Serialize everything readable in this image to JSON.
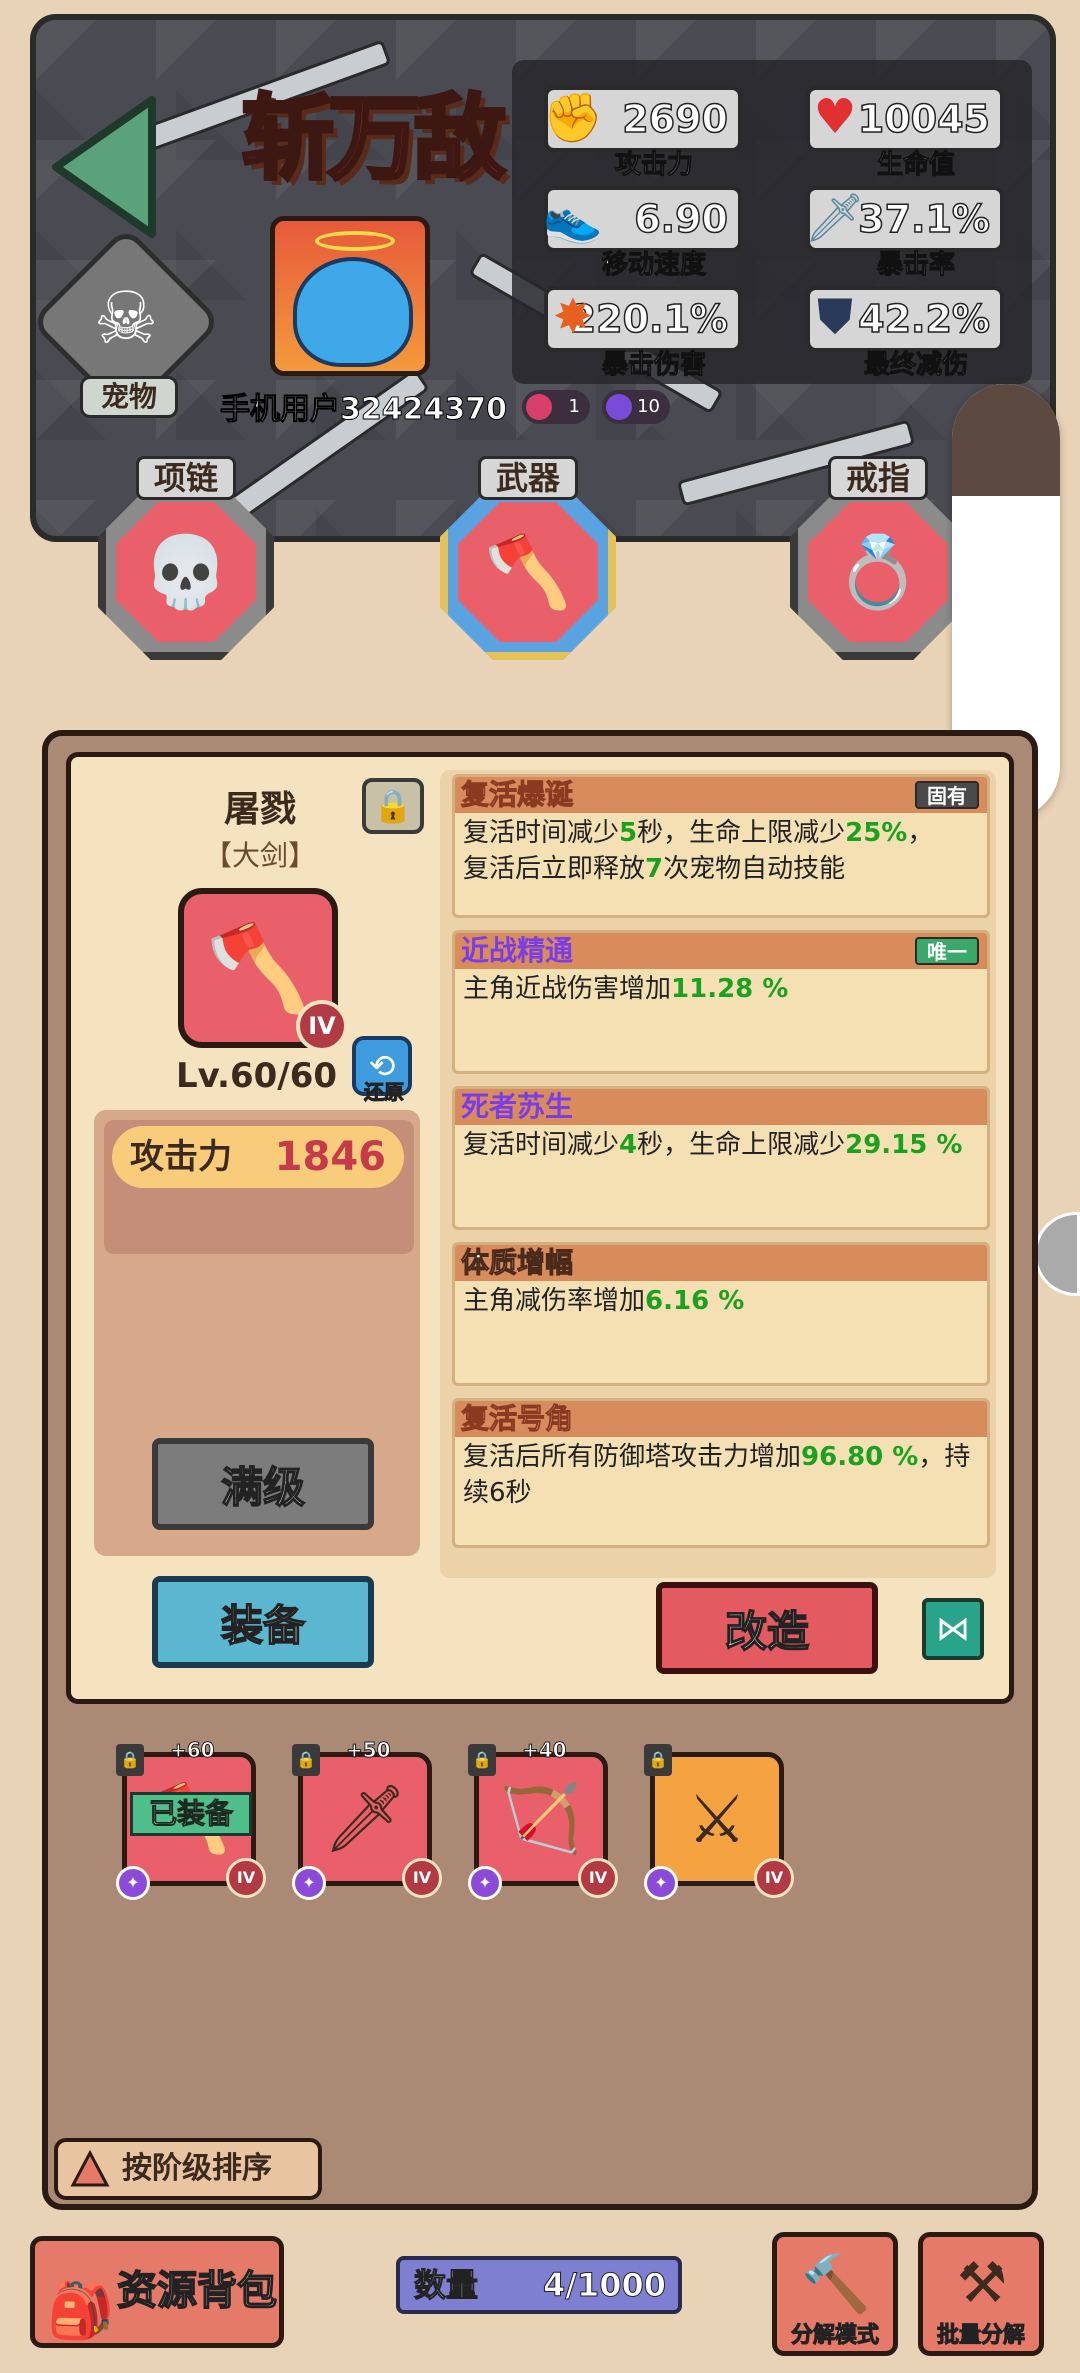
{
  "header": {
    "logo_text": "斩万敌",
    "pet_label": "宠物",
    "username": "手机用户32424370",
    "stats": [
      {
        "icon": "fist-icon",
        "value": "2690",
        "label": "攻击力"
      },
      {
        "icon": "heart-icon",
        "value": "10045",
        "label": "生命值"
      },
      {
        "icon": "shoe-icon",
        "value": "6.90",
        "label": "移动速度"
      },
      {
        "icon": "dagger-icon",
        "value": "37.1%",
        "label": "暴击率"
      },
      {
        "icon": "explosion-icon",
        "value": "220.1%",
        "label": "暴击伤害"
      },
      {
        "icon": "shield-icon",
        "value": "42.2%",
        "label": "最终减伤"
      }
    ],
    "chips": [
      {
        "value": "1"
      },
      {
        "value": "10"
      }
    ]
  },
  "slots": {
    "necklace": "项链",
    "weapon": "武器",
    "ring": "戒指"
  },
  "item": {
    "name": "屠戮",
    "type": "【大剑】",
    "tier": "IV",
    "level": "Lv.60/60",
    "restore_label": "还原",
    "attack_label": "攻击力",
    "attack_value": "1846",
    "max_level_label": "满级",
    "equip_label": "装备",
    "reforge_label": "改造"
  },
  "skills": [
    {
      "name": "复活爆诞",
      "tag": "固有",
      "parts": [
        "复活时间减少",
        "5",
        "秒，生命上限减少",
        "25%",
        "，",
        "复活后立即释放",
        "7",
        "次宠物自动技能"
      ]
    },
    {
      "name": "近战精通",
      "tag": "唯一",
      "parts": [
        "主角近战伤害增加",
        "11.28 %"
      ]
    },
    {
      "name": "死者苏生",
      "tag": "",
      "parts": [
        "复活时间减少",
        "4",
        "秒，生命上限减少",
        "29.15 %"
      ]
    },
    {
      "name": "体质增幅",
      "tag": "",
      "parts": [
        "主角减伤率增加",
        "6.16 %"
      ]
    },
    {
      "name": "复活号角",
      "tag": "",
      "parts": [
        "复活后所有防御塔攻击力增加",
        "96.80 %",
        "，持续6秒"
      ]
    }
  ],
  "inventory": [
    {
      "plus": "+60",
      "tier": "IV",
      "equipped_label": "已装备",
      "icon": "axe-icon"
    },
    {
      "plus": "+50",
      "tier": "IV",
      "icon": "sword-icon"
    },
    {
      "plus": "+40",
      "tier": "IV",
      "icon": "bow-icon"
    },
    {
      "plus": "",
      "tier": "IV",
      "icon": "crossbow-icon"
    }
  ],
  "sort_label": "按阶级排序",
  "bottom": {
    "bag_label": "资源背包",
    "count_label": "数量",
    "count_value": "4/1000",
    "decompose_mode_label": "分解模式",
    "batch_decompose_label": "批量分解"
  }
}
